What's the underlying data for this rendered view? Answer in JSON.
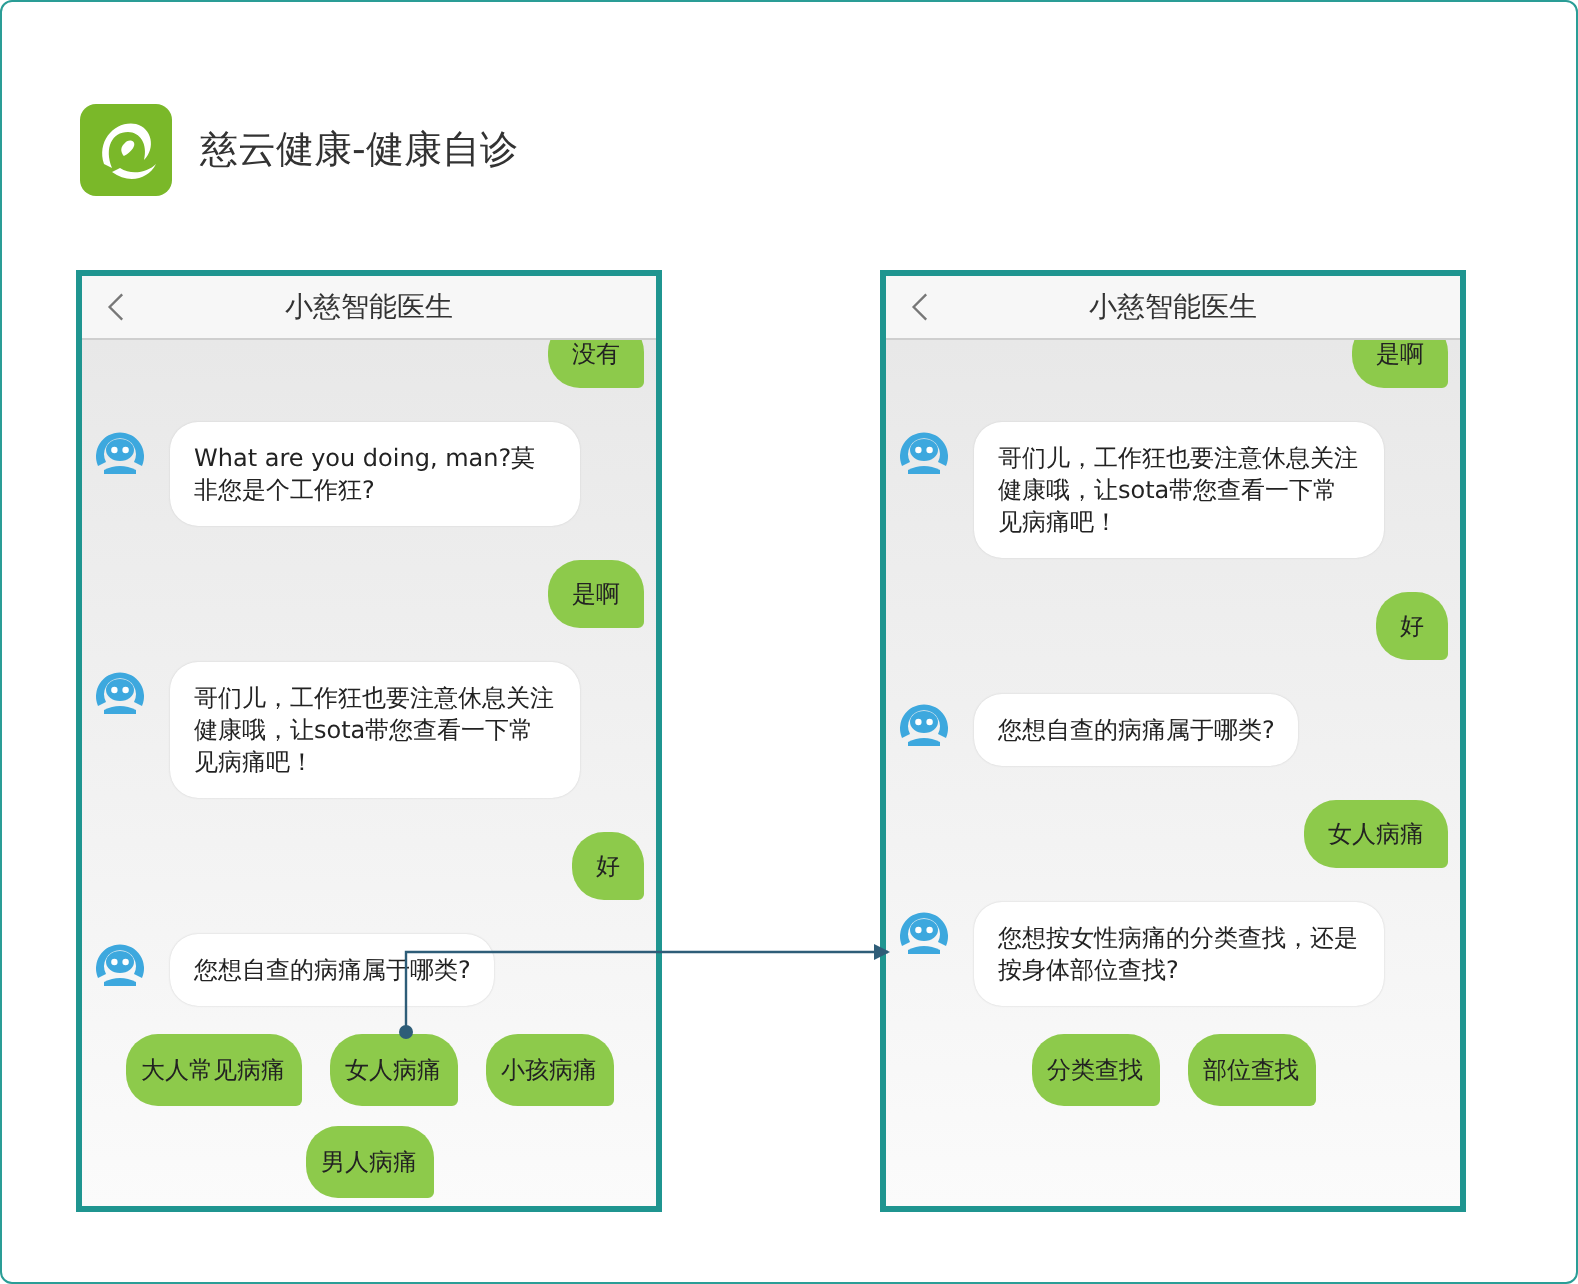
{
  "header": {
    "title": "慈云健康-健康自诊"
  },
  "screens": [
    {
      "title": "小慈智能医生",
      "messages": [
        {
          "kind": "user",
          "text": "没有"
        },
        {
          "kind": "bot",
          "text": "What are you doing, man?莫非您是个工作狂?"
        },
        {
          "kind": "user",
          "text": "是啊"
        },
        {
          "kind": "bot",
          "text": "哥们儿，工作狂也要注意休息关注健康哦，让sota带您查看一下常见病痛吧！"
        },
        {
          "kind": "user",
          "text": "好"
        },
        {
          "kind": "bot",
          "text": "您想自查的病痛属于哪类?"
        }
      ],
      "option_rows": [
        [
          "大人常见病痛",
          "女人病痛",
          "小孩病痛"
        ],
        [
          "男人病痛"
        ]
      ]
    },
    {
      "title": "小慈智能医生",
      "messages": [
        {
          "kind": "user",
          "text": "是啊"
        },
        {
          "kind": "bot",
          "text": "哥们儿，工作狂也要注意休息关注健康哦，让sota带您查看一下常见病痛吧！"
        },
        {
          "kind": "user",
          "text": "好"
        },
        {
          "kind": "bot",
          "text": "您想自查的病痛属于哪类?"
        },
        {
          "kind": "user",
          "text": "女人病痛"
        },
        {
          "kind": "bot",
          "text": "您想按女性病痛的分类查找，还是按身体部位查找?"
        }
      ],
      "option_rows": [
        [
          "分类查找",
          "部位查找"
        ]
      ]
    }
  ]
}
